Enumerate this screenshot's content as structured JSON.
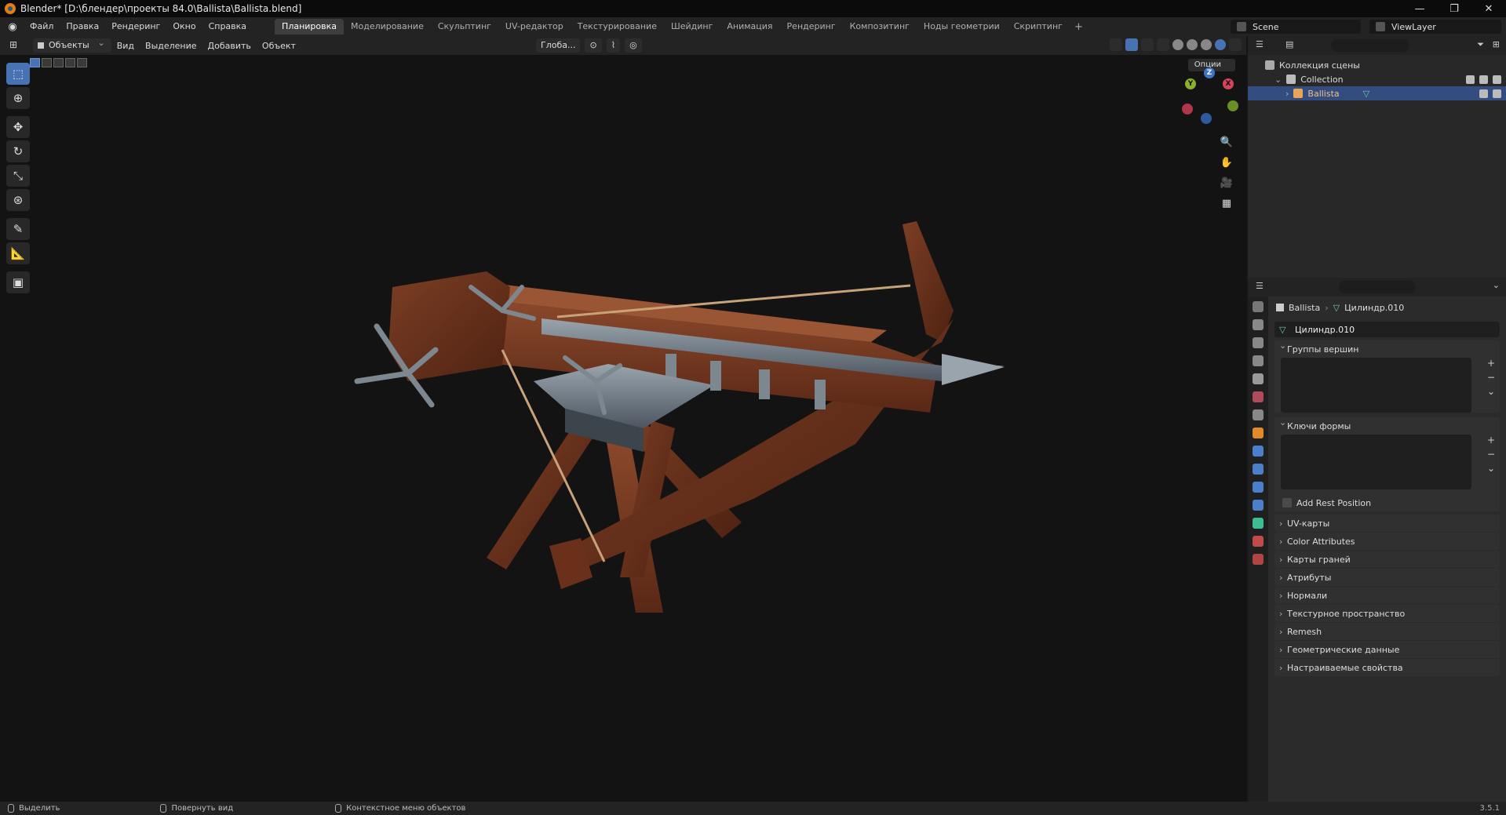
{
  "window": {
    "title": "Blender* [D:\\блендер\\проекты 84.0\\Ballista\\Ballista.blend]",
    "controls": [
      "—",
      "❐",
      "✕"
    ]
  },
  "menu": [
    "Файл",
    "Правка",
    "Рендеринг",
    "Окно",
    "Справка"
  ],
  "workspaces": [
    "Планировка",
    "Моделирование",
    "Скульптинг",
    "UV-редактор",
    "Текстурирование",
    "Шейдинг",
    "Анимация",
    "Рендеринг",
    "Композитинг",
    "Ноды геометрии",
    "Скриптинг"
  ],
  "active_workspace_index": 0,
  "scene_name": "Scene",
  "view_layer_name": "ViewLayer",
  "viewport": {
    "mode": "Объекты",
    "menus": [
      "Вид",
      "Выделение",
      "Добавить",
      "Объект"
    ],
    "transform_orientation": "Глоба...",
    "options_label": "Опции",
    "gizmo_axes": {
      "x": "X",
      "y": "Y",
      "z": "Z"
    }
  },
  "outliner": {
    "scene_collection": "Коллекция сцены",
    "collection": "Collection",
    "object": "Ballista"
  },
  "properties": {
    "breadcrumb_object": "Ballista",
    "breadcrumb_mesh": "Цилиндр.010",
    "mesh_name": "Цилиндр.010",
    "panels_open": [
      "Группы вершин",
      "Ключи формы"
    ],
    "add_rest_position": "Add Rest Position",
    "panels_collapsed": [
      "UV-карты",
      "Color Attributes",
      "Карты граней",
      "Атрибуты",
      "Нормали",
      "Текстурное пространство",
      "Remesh",
      "Геометрические данные",
      "Настраиваемые свойства"
    ]
  },
  "status": {
    "left": "Выделить",
    "middle": "Повернуть вид",
    "right": "Контекстное меню объектов",
    "version": "3.5.1"
  },
  "colors": {
    "accent": "#4772b3",
    "viewport_bg": "#131313",
    "wood": "#7a3b22",
    "metal": "#6e7a86"
  }
}
